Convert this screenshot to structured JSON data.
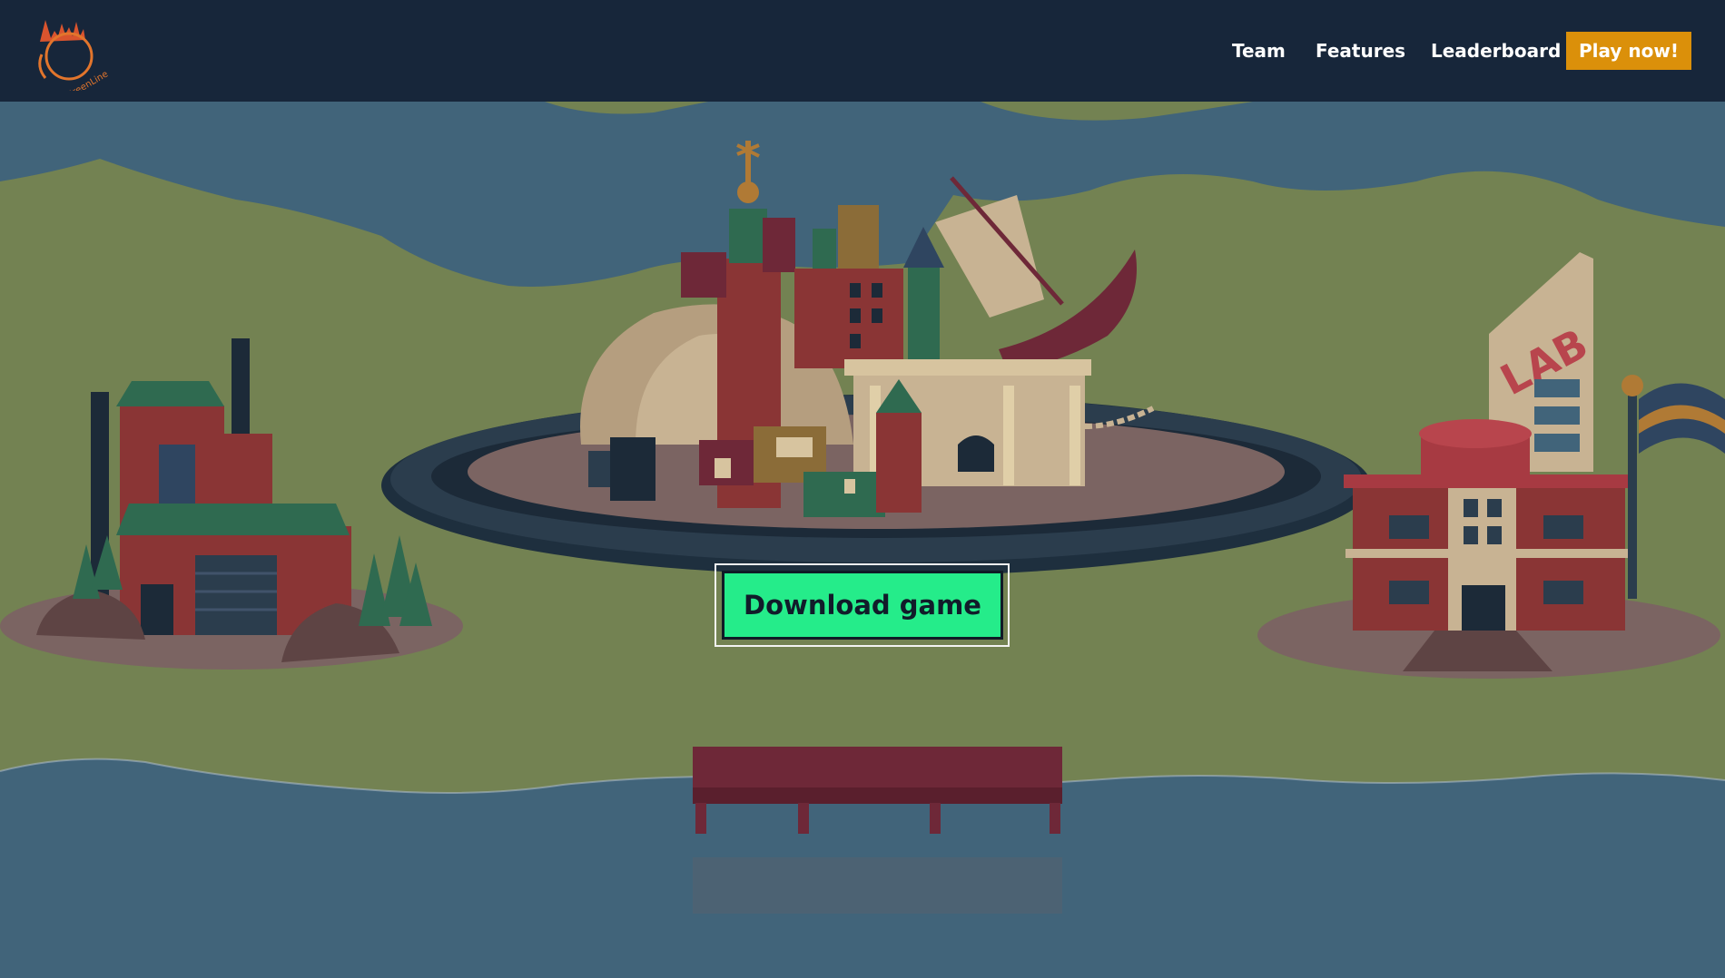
{
  "header": {
    "logo_text": "GreenLine",
    "nav": {
      "team": "Team",
      "features": "Features",
      "leaderboard": "Leaderboard",
      "play": "Play now!"
    }
  },
  "hero": {
    "download_label": "Download game",
    "lab_sign": "LAB"
  },
  "colors": {
    "nav_bg": "#17263a",
    "play_button": "#db900a",
    "download_button": "#25ec8a",
    "land": "#738252",
    "water": "#41647a"
  }
}
